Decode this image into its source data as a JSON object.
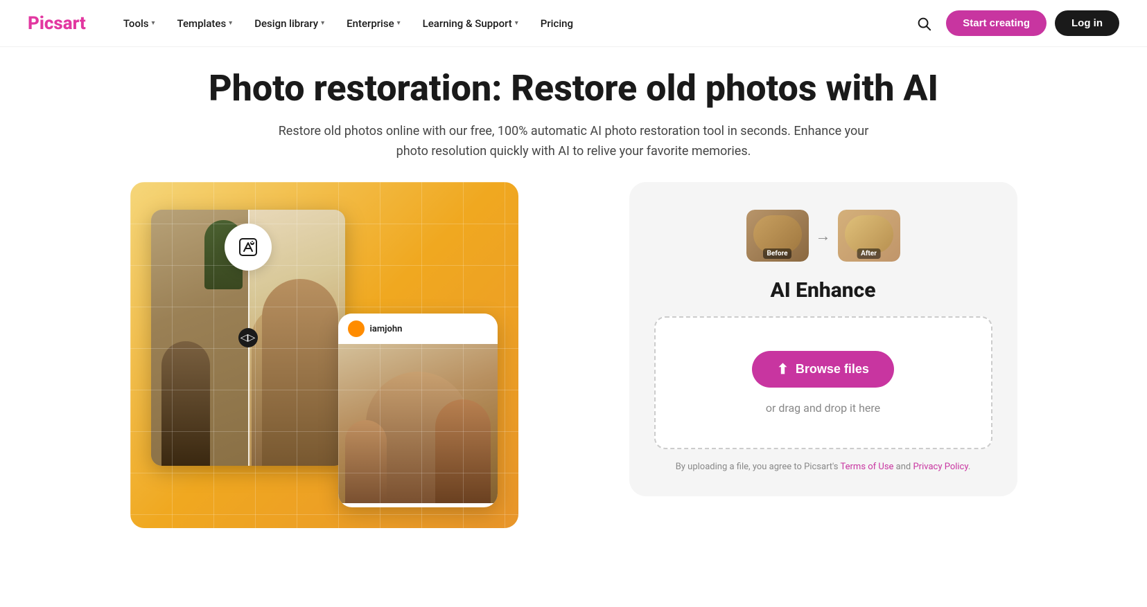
{
  "brand": {
    "name_p1": "Pics",
    "name_p2": "art"
  },
  "nav": {
    "items": [
      {
        "label": "Tools",
        "has_dropdown": true
      },
      {
        "label": "Templates",
        "has_dropdown": true
      },
      {
        "label": "Design library",
        "has_dropdown": true
      },
      {
        "label": "Enterprise",
        "has_dropdown": true
      },
      {
        "label": "Learning & Support",
        "has_dropdown": true
      },
      {
        "label": "Pricing",
        "has_dropdown": false
      }
    ],
    "start_creating": "Start creating",
    "log_in": "Log in"
  },
  "hero": {
    "title": "Photo restoration: Restore old photos with AI",
    "subtitle": "Restore old photos online with our free, 100% automatic AI photo restoration tool in seconds. Enhance your photo resolution quickly with AI to relive your favorite memories."
  },
  "panel": {
    "title": "AI Enhance",
    "before_label": "Before",
    "after_label": "After",
    "browse_label": "Browse files",
    "drag_label": "or drag and drop it here",
    "terms_text_1": "By uploading a file, you agree to Picsart's ",
    "terms_of_use": "Terms of Use",
    "terms_text_2": " and ",
    "privacy_policy": "Privacy Policy",
    "terms_text_3": "."
  },
  "user": {
    "username": "iamjohn"
  }
}
